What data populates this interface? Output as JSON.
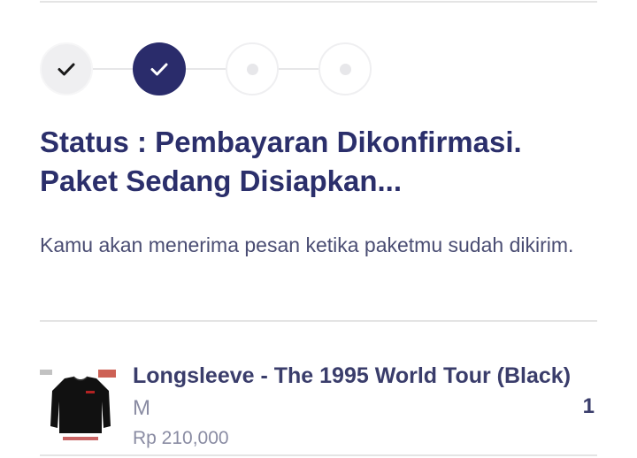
{
  "stepper": {
    "steps": [
      {
        "state": "done",
        "icon": "check-icon"
      },
      {
        "state": "current",
        "icon": "check-icon"
      },
      {
        "state": "pending",
        "icon": "dot-icon"
      },
      {
        "state": "pending",
        "icon": "dot-icon"
      }
    ],
    "colors": {
      "current": "#2a2c6b",
      "done": "#efeff1",
      "pending": "#e7e7ea"
    }
  },
  "status": {
    "title": "Status : Pembayaran Dikonfirmasi. Paket Sedang Disiapkan...",
    "description": "Kamu akan menerima pesan ketika paketmu sudah dikirim."
  },
  "order_item": {
    "name": "Longsleeve - The 1995 World Tour (Black)",
    "variant": "M",
    "price": "Rp 210,000",
    "quantity": "1",
    "thumbnail_icon": "black-longsleeve-shirt-image"
  },
  "colors": {
    "primary_text": "#2b2f6b",
    "muted_text": "#8a8ca3",
    "divider": "#e4e4e4"
  }
}
